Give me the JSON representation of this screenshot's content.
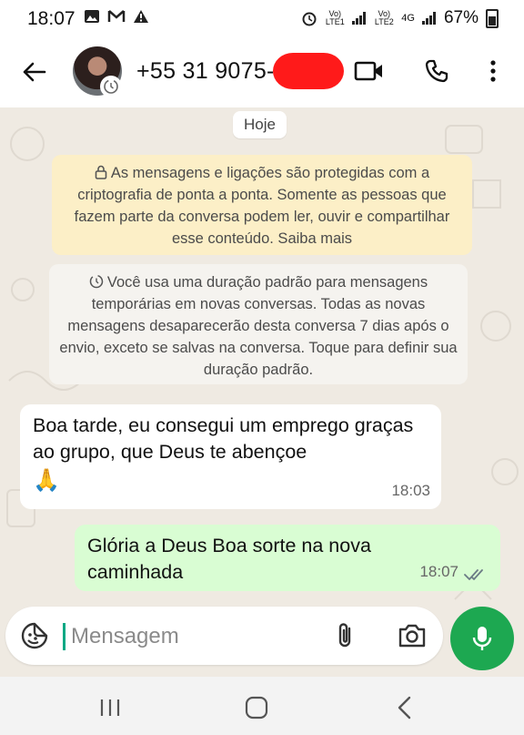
{
  "status_bar": {
    "time": "18:07",
    "sim1_label": "Vo) LTE1",
    "sim2_label": "Vo) LTE2",
    "network": "4G",
    "battery": "67%"
  },
  "header": {
    "contact_name": "+55 31 9075-"
  },
  "chat": {
    "date_label": "Hoje",
    "encryption_notice": "As mensagens e ligações são protegidas com a criptografia de ponta a ponta. Somente as pessoas que fazem parte da conversa podem ler, ouvir e compartilhar esse conteúdo. Saiba mais",
    "temporary_notice": "Você usa uma duração padrão para mensagens temporárias em novas conversas. Todas as novas mensagens desaparecerão desta conversa 7 dias após o envio, exceto se salvas na conversa. Toque para definir sua duração padrão.",
    "messages": [
      {
        "direction": "in",
        "text": "Boa tarde, eu consegui um emprego graças ao grupo, que Deus te abençoe",
        "emoji": "🙏",
        "time": "18:03"
      },
      {
        "direction": "out",
        "text": "Glória a Deus Boa sorte na nova caminhada",
        "time": "18:07"
      }
    ]
  },
  "composer": {
    "placeholder": "Mensagem"
  },
  "colors": {
    "accent": "#1da851",
    "outgoing_bubble": "#d9fdd3",
    "encryption_bg": "#fcefc7",
    "redaction": "#ff1a1a"
  }
}
